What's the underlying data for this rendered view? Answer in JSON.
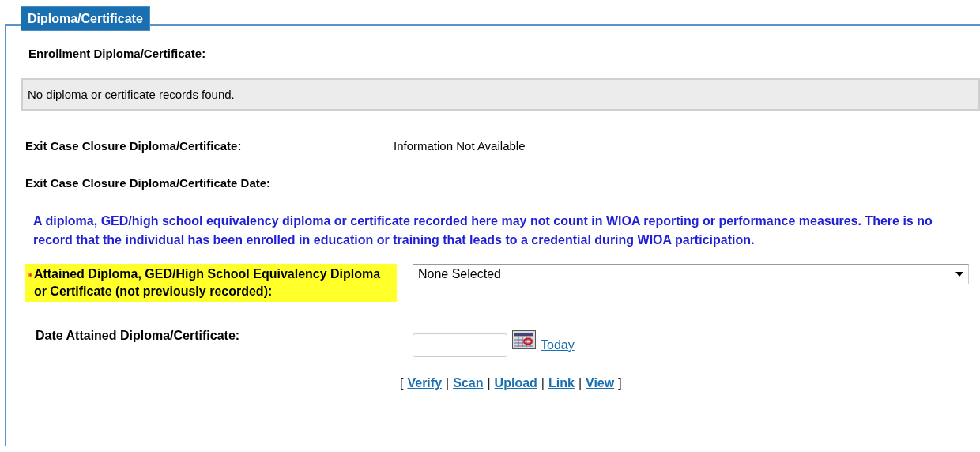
{
  "panel": {
    "title": "Diploma/Certificate"
  },
  "enrollment": {
    "heading": "Enrollment Diploma/Certificate:",
    "empty_message": "No diploma or certificate records found."
  },
  "info_rows": [
    {
      "label": "Exit Case Closure Diploma/Certificate:",
      "value": "Information Not Available"
    },
    {
      "label": "Exit Case Closure Diploma/Certificate Date:"
    }
  ],
  "notice": "A diploma, GED/high school equivalency diploma or certificate recorded here may not count in WIOA reporting or performance measures. There is no record that the individual has been enrolled in education or training that leads to a credential during WIOA participation.",
  "fields": [
    {
      "kind": "dropdown",
      "label": "Attained Diploma, GED/High School Equivalency Diploma or Certificate (not previously recorded):",
      "required": true,
      "highlighted": true,
      "value": "None Selected"
    },
    {
      "kind": "date",
      "label": "Date Attained Diploma/Certificate:",
      "required": false,
      "highlighted": false,
      "link": "Today"
    }
  ],
  "actions": [
    {
      "kind": "text",
      "text": "["
    },
    {
      "kind": "link",
      "text": "Verify"
    },
    {
      "kind": "text",
      "text": "|"
    },
    {
      "kind": "link",
      "text": "Scan"
    },
    {
      "kind": "text",
      "text": "|"
    },
    {
      "kind": "link",
      "text": "Upload"
    },
    {
      "kind": "text",
      "text": "|"
    },
    {
      "kind": "link",
      "text": "Link"
    },
    {
      "kind": "text",
      "text": "|"
    },
    {
      "kind": "link",
      "text": "View"
    },
    {
      "kind": "text",
      "text": "]"
    }
  ]
}
